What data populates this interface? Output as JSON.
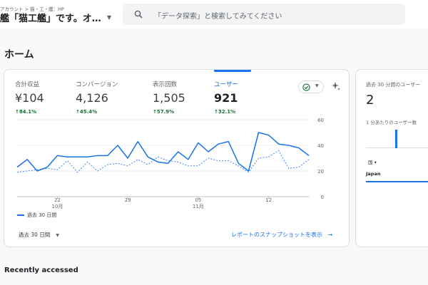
{
  "header": {
    "breadcrumb": "アカウント > 猫・工・艦：HP",
    "property_name": "艦「猫工艦」です。オ…",
    "search_placeholder": "「データ探索」と検索してみてください"
  },
  "page_title": "ホーム",
  "metrics": [
    {
      "label": "合計収益",
      "value": "¥104",
      "change": "↑84.1%"
    },
    {
      "label": "コンバージョン",
      "value": "4,126",
      "change": "↑45.4%"
    },
    {
      "label": "表示回数",
      "value": "1,505",
      "change": "↑57.9%"
    },
    {
      "label": "ユーザー",
      "value": "921",
      "change": "↑32.1%"
    }
  ],
  "legend_label": "過去 30 日間",
  "date_range": "過去 30 日間",
  "snapshot_link": "レポートのスナップショットを表示",
  "chart_data": {
    "type": "line",
    "x_tick_labels": [
      {
        "day": "22",
        "month": "10月"
      },
      {
        "day": "29",
        "month": ""
      },
      {
        "day": "05",
        "month": "11月"
      },
      {
        "day": "12",
        "month": ""
      }
    ],
    "y_tick_labels": [
      "60",
      "40",
      "20",
      "0"
    ],
    "ylim": [
      0,
      60
    ],
    "series": [
      {
        "name": "過去 30 日間",
        "style": "solid",
        "color": "#1a73e8",
        "values": [
          23,
          29,
          20,
          23,
          32,
          31,
          31,
          31,
          32,
          32,
          40,
          30,
          43,
          31,
          27,
          26,
          35,
          29,
          42,
          35,
          41,
          43,
          26,
          20,
          50,
          48,
          41,
          40,
          38,
          32
        ]
      },
      {
        "name": "",
        "style": "dotted",
        "color": "#4285f4",
        "values": [
          19,
          20,
          21,
          22,
          21,
          28,
          19,
          27,
          20,
          25,
          26,
          24,
          29,
          25,
          31,
          28,
          27,
          24,
          24,
          30,
          28,
          28,
          24,
          19,
          30,
          31,
          36,
          22,
          23,
          29
        ]
      }
    ]
  },
  "side": {
    "title": "過去 30 分間のユーザー",
    "value": "2",
    "subtitle": "1 分あたりのユーザー数",
    "mini_bars": [
      0,
      0,
      0,
      0,
      0,
      0,
      0,
      0,
      1,
      0,
      0,
      0,
      0,
      0,
      0,
      0,
      0,
      0,
      0,
      0
    ],
    "column_header": "国 ▾",
    "row_country": "Japan"
  },
  "recent_title": "Recently accessed",
  "colors": {
    "accent": "#1a73e8",
    "positive": "#137333"
  }
}
